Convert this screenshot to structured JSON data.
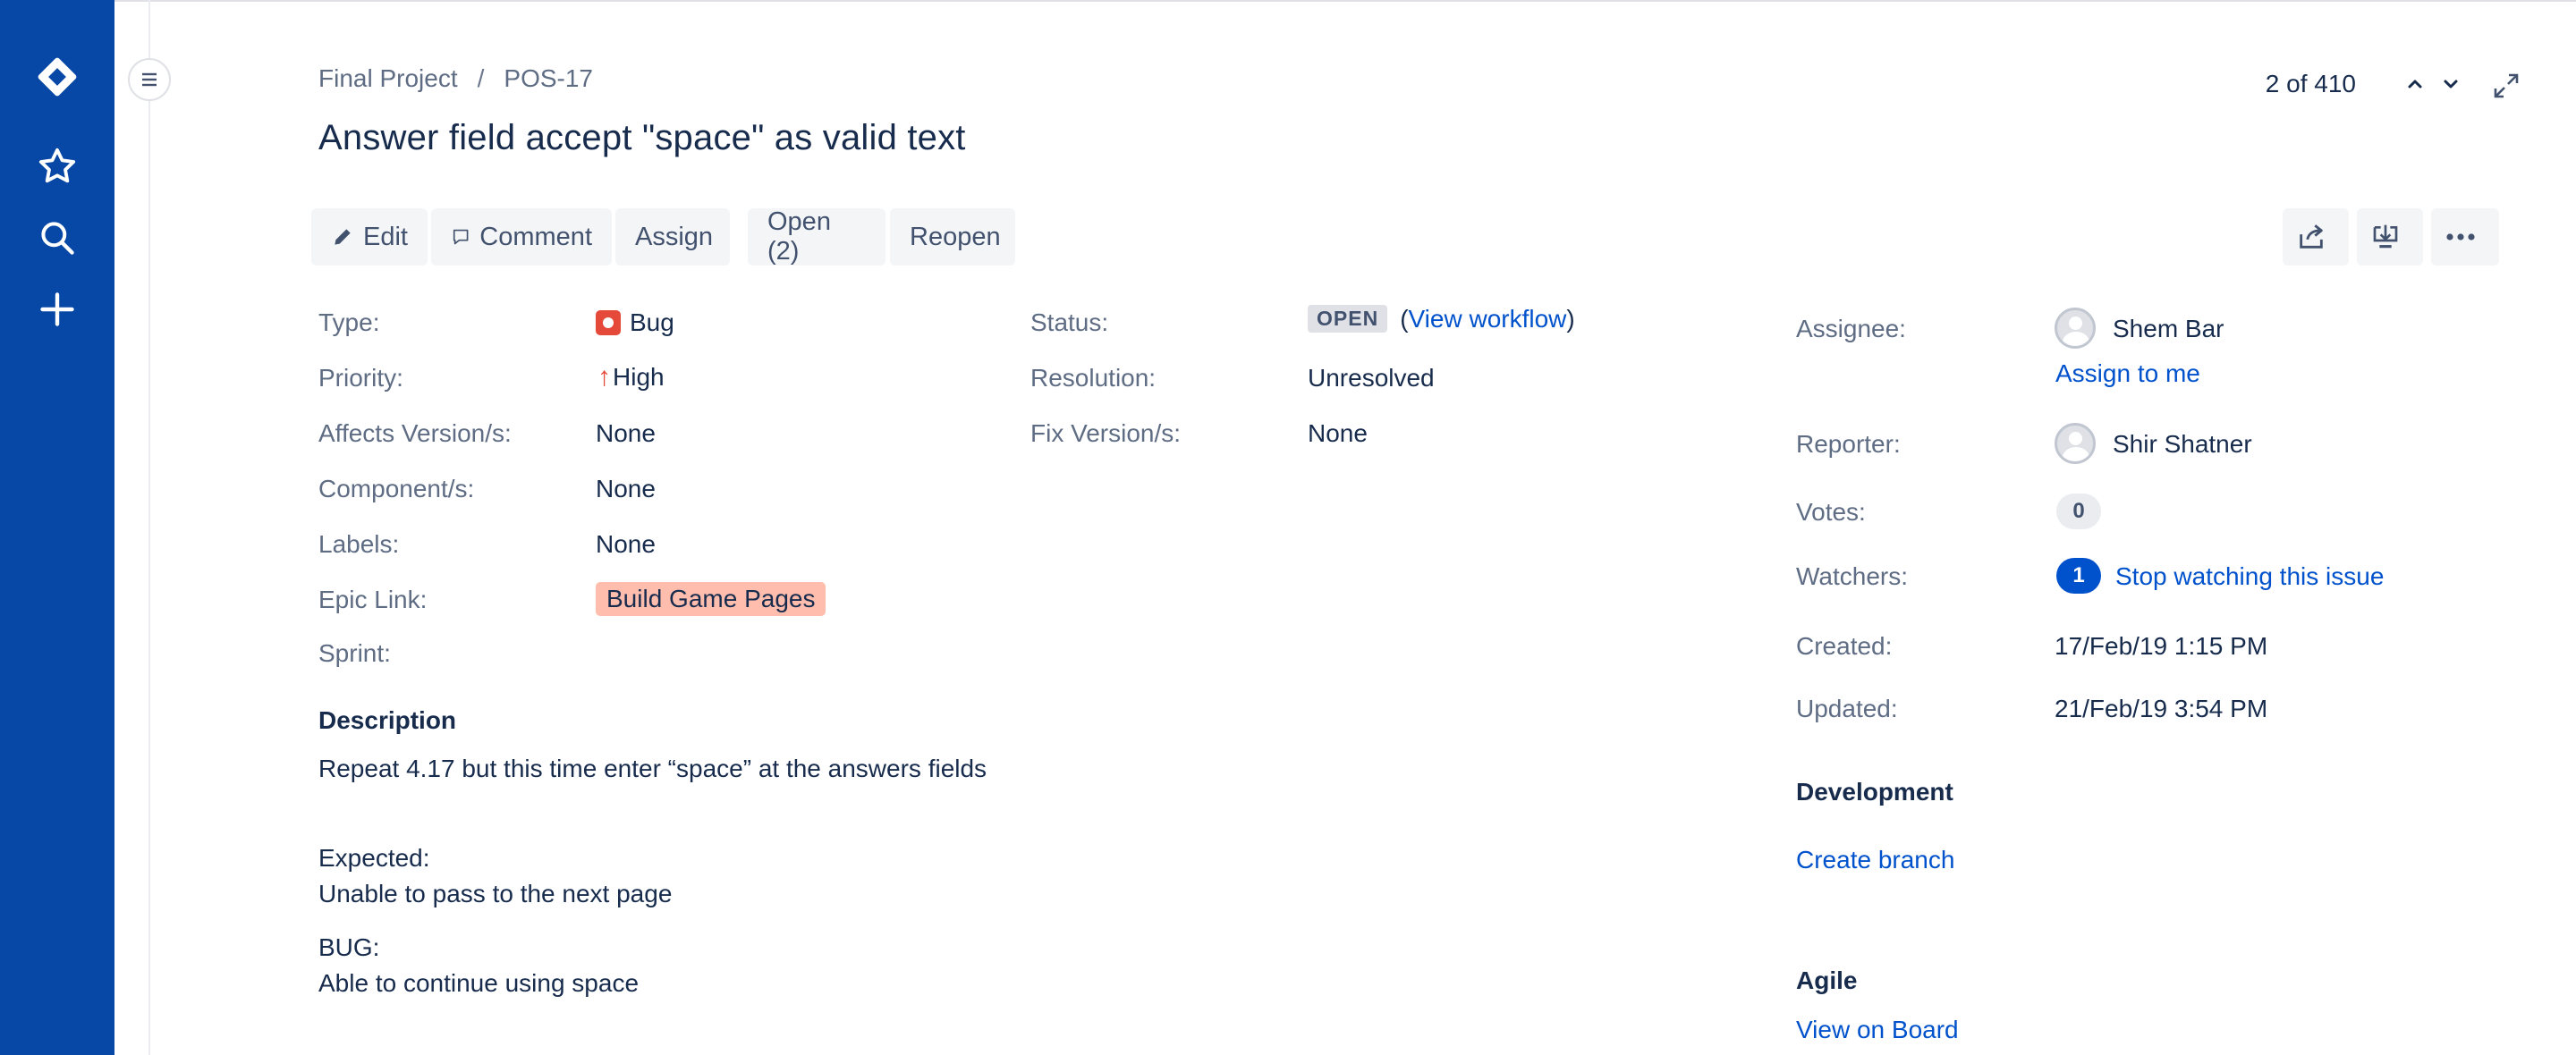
{
  "breadcrumb": {
    "project": "Final Project",
    "separator": "/",
    "issue_key": "POS-17"
  },
  "issue": {
    "title": "Answer field accept \"space\" as valid text"
  },
  "pager": {
    "text": "2 of 410"
  },
  "toolbar": {
    "edit": "Edit",
    "comment": "Comment",
    "assign": "Assign",
    "open": "Open (2)",
    "reopen": "Reopen"
  },
  "details": {
    "type_label": "Type:",
    "type_value": "Bug",
    "priority_label": "Priority:",
    "priority_value": "High",
    "affects_label": "Affects Version/s:",
    "affects_value": "None",
    "component_label": "Component/s:",
    "component_value": "None",
    "labels_label": "Labels:",
    "labels_value": "None",
    "epic_label": "Epic Link:",
    "epic_value": "Build Game Pages",
    "sprint_label": "Sprint:"
  },
  "status": {
    "status_label": "Status:",
    "status_value": "OPEN",
    "paren_open": "(",
    "workflow_link": "View workflow",
    "paren_close": ")",
    "resolution_label": "Resolution:",
    "resolution_value": "Unresolved",
    "fix_label": "Fix Version/s:",
    "fix_value": "None"
  },
  "people": {
    "assignee_label": "Assignee:",
    "assignee_name": "Shem Bar",
    "assign_to_me": "Assign to me",
    "reporter_label": "Reporter:",
    "reporter_name": "Shir Shatner",
    "votes_label": "Votes:",
    "votes_count": "0",
    "watchers_label": "Watchers:",
    "watchers_count": "1",
    "stop_watching": "Stop watching this issue"
  },
  "dates": {
    "created_label": "Created:",
    "created_value": "17/Feb/19 1:15 PM",
    "updated_label": "Updated:",
    "updated_value": "21/Feb/19 3:54 PM"
  },
  "description": {
    "heading": "Description",
    "line1": "Repeat 4.17 but this time enter “space” at the answers fields",
    "line2": "Expected:",
    "line3": "Unable to pass to the next page",
    "line4": "BUG:",
    "line5": "Able to continue using space"
  },
  "development": {
    "heading": "Development",
    "create_branch": "Create branch"
  },
  "agile": {
    "heading": "Agile",
    "view_on_board": "View on Board"
  },
  "colors": {
    "sidebar": "#0747a6",
    "link": "#0052cc",
    "bug": "#e5493a",
    "epic": "#ffbdad"
  },
  "icons": [
    "jira-logo-icon",
    "star-icon",
    "search-icon",
    "plus-icon",
    "menu-icon",
    "chevron-up-icon",
    "chevron-down-icon",
    "expand-icon",
    "pencil-icon",
    "comment-icon",
    "share-icon",
    "export-icon",
    "more-icon",
    "bug-icon",
    "priority-high-icon",
    "avatar"
  ]
}
